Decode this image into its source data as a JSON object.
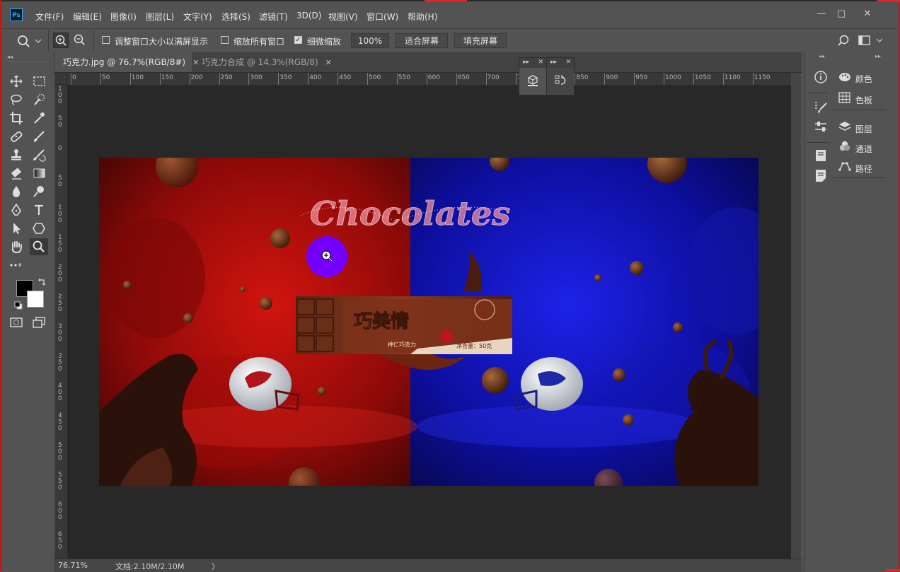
{
  "app": {
    "logo": "Ps"
  },
  "menu": [
    "文件(F)",
    "编辑(E)",
    "图像(I)",
    "图层(L)",
    "文字(Y)",
    "选择(S)",
    "滤镜(T)",
    "3D(D)",
    "视图(V)",
    "窗口(W)",
    "帮助(H)"
  ],
  "window_controls": {
    "minimize": "—",
    "restore": "□",
    "close": "✕"
  },
  "options": {
    "resize_windows_label": "调整窗口大小以满屏显示",
    "zoom_all_label": "缩放所有窗口",
    "scrubby_zoom_label": "细微缩放",
    "scrubby_checked": true,
    "zoom_value": "100%",
    "fit_screen": "适合屏幕",
    "fill_screen": "填充屏幕"
  },
  "tabs": [
    {
      "label": "巧克力.jpg @ 76.7%(RGB/8#)",
      "active": true
    },
    {
      "label": "巧克力合成  @ 14.3%(RGB/8)",
      "active": false
    }
  ],
  "ruler_h": [
    "0",
    "50",
    "100",
    "150",
    "200",
    "250",
    "300",
    "350",
    "400",
    "450",
    "500",
    "550",
    "600",
    "650",
    "700",
    "750",
    "800",
    "850",
    "900",
    "950",
    "1000",
    "1050",
    "1100",
    "1150"
  ],
  "ruler_v": [
    "1\n0\n0",
    "5\n0",
    "0",
    "5\n0",
    "1\n0\n0",
    "1\n5\n0",
    "2\n0\n0",
    "2\n5\n0",
    "3\n0\n0",
    "3\n5\n0",
    "4\n0\n0",
    "4\n5\n0",
    "5\n0\n0",
    "5\n5\n0",
    "6\n0\n0",
    "6\n5\n0"
  ],
  "image": {
    "title_text": "Chocolates",
    "brand_text": "巧美情",
    "product_text": "棒仁巧克力",
    "weight_text": "净含量：50克"
  },
  "status": {
    "zoom": "76.71%",
    "doc": "文档:2.10M/2.10M",
    "arrow": "〉"
  },
  "panels": {
    "color": "颜色",
    "swatches": "色板",
    "layers": "图层",
    "channels": "通道",
    "paths": "路径"
  },
  "colors": {
    "foreground": "#000000",
    "background": "#ffffff",
    "cursor": "#7300ff"
  }
}
